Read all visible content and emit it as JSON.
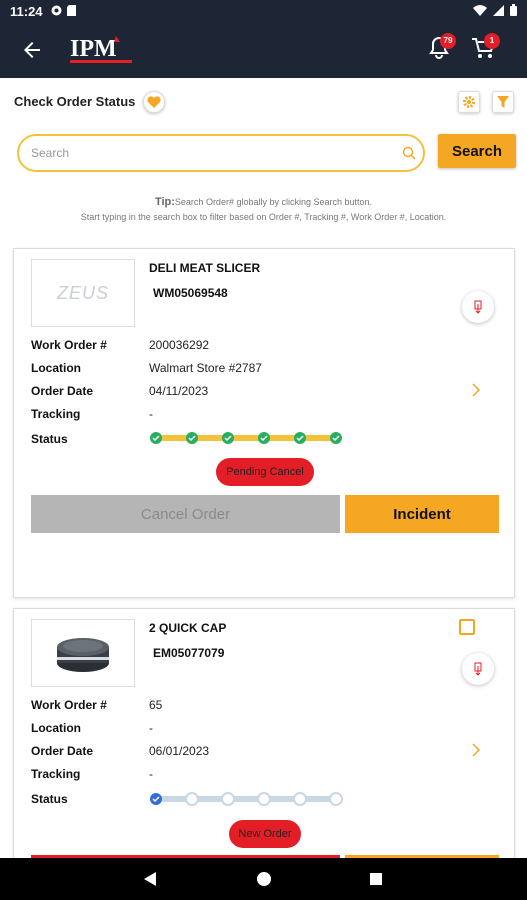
{
  "status_bar": {
    "time": "11:24"
  },
  "header": {
    "logo_text": "IPM",
    "notification_count": "79",
    "cart_count": "1"
  },
  "page": {
    "title": "Check Order Status"
  },
  "search": {
    "placeholder": "Search",
    "button_label": "Search"
  },
  "tip": {
    "label": "Tip:",
    "line1": "Search Order# globally by clicking Search button.",
    "line2": "Start typing in the search box to filter based on Order #, Tracking #, Work Order #, Location."
  },
  "labels": {
    "work_order": "Work Order #",
    "location": "Location",
    "order_date": "Order Date",
    "tracking": "Tracking",
    "status": "Status"
  },
  "orders": [
    {
      "image_brand": "ZEUS",
      "product_name": "DELI MEAT SLICER",
      "product_code": "WM05069548",
      "work_order": "200036292",
      "location": "Walmart Store #2787",
      "order_date": "04/11/2023",
      "tracking": "-",
      "status_steps_completed": 6,
      "status_steps_total": 6,
      "status_pill": "Pending Cancel",
      "cancel_label": "Cancel Order",
      "incident_label": "Incident"
    },
    {
      "product_name": "2 QUICK CAP",
      "product_code": "EM05077079",
      "work_order": "65",
      "location": "-",
      "order_date": "06/01/2023",
      "tracking": "-",
      "status_steps_completed": 1,
      "status_steps_total": 6,
      "status_pill": "New Order"
    }
  ],
  "colors": {
    "header_bg": "#1e2535",
    "accent": "#f5a623",
    "danger": "#e41e26",
    "success": "#27ae60",
    "pending_track": "#c9d6e3"
  }
}
